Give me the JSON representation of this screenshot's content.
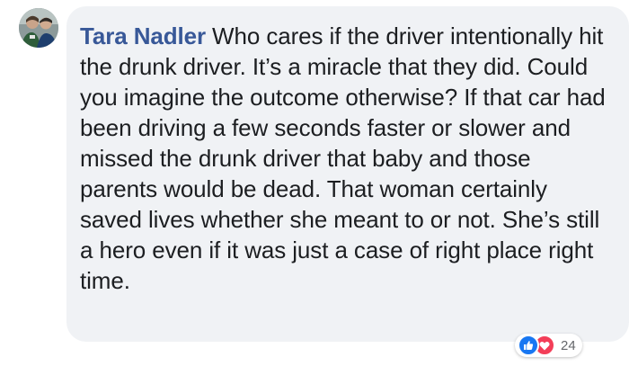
{
  "comment": {
    "author": "Tara Nadler",
    "text": "Who cares if the driver intentionally hit the drunk driver. It’s a miracle that they did. Could you imagine the outcome otherwise? If that car had been driving a few seconds faster or slower and missed the drunk driver that baby and those parents would be dead. That woman certainly saved lives whether she meant to or not. She’s still a hero even if it was just a case of right place right time."
  },
  "reactions": {
    "types": [
      "like-icon",
      "love-icon"
    ],
    "count": "24"
  },
  "colors": {
    "author": "#385898",
    "bubble": "#f0f2f5",
    "text": "#1c1e21",
    "like": "#1877f2",
    "love": "#f33e58"
  }
}
